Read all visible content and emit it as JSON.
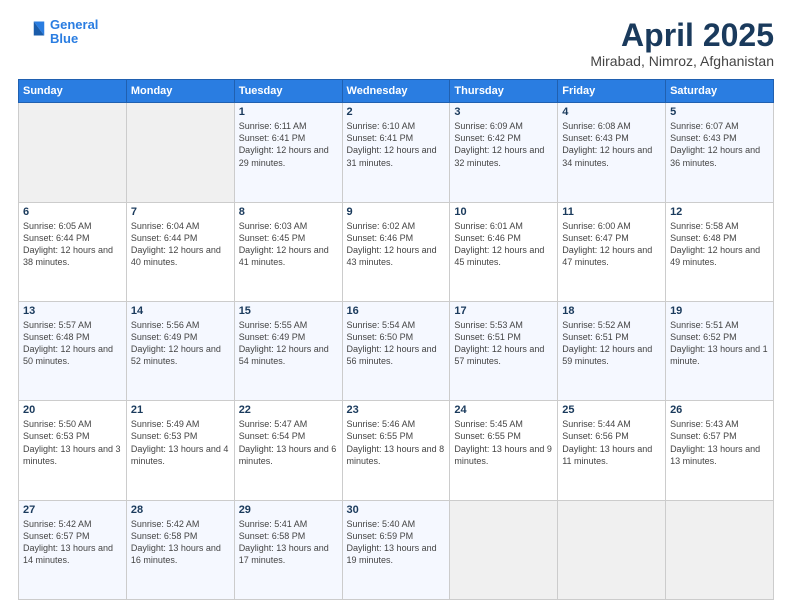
{
  "logo": {
    "line1": "General",
    "line2": "Blue"
  },
  "title": "April 2025",
  "subtitle": "Mirabad, Nimroz, Afghanistan",
  "days_of_week": [
    "Sunday",
    "Monday",
    "Tuesday",
    "Wednesday",
    "Thursday",
    "Friday",
    "Saturday"
  ],
  "weeks": [
    [
      {
        "num": "",
        "sunrise": "",
        "sunset": "",
        "daylight": ""
      },
      {
        "num": "",
        "sunrise": "",
        "sunset": "",
        "daylight": ""
      },
      {
        "num": "1",
        "sunrise": "Sunrise: 6:11 AM",
        "sunset": "Sunset: 6:41 PM",
        "daylight": "Daylight: 12 hours and 29 minutes."
      },
      {
        "num": "2",
        "sunrise": "Sunrise: 6:10 AM",
        "sunset": "Sunset: 6:41 PM",
        "daylight": "Daylight: 12 hours and 31 minutes."
      },
      {
        "num": "3",
        "sunrise": "Sunrise: 6:09 AM",
        "sunset": "Sunset: 6:42 PM",
        "daylight": "Daylight: 12 hours and 32 minutes."
      },
      {
        "num": "4",
        "sunrise": "Sunrise: 6:08 AM",
        "sunset": "Sunset: 6:43 PM",
        "daylight": "Daylight: 12 hours and 34 minutes."
      },
      {
        "num": "5",
        "sunrise": "Sunrise: 6:07 AM",
        "sunset": "Sunset: 6:43 PM",
        "daylight": "Daylight: 12 hours and 36 minutes."
      }
    ],
    [
      {
        "num": "6",
        "sunrise": "Sunrise: 6:05 AM",
        "sunset": "Sunset: 6:44 PM",
        "daylight": "Daylight: 12 hours and 38 minutes."
      },
      {
        "num": "7",
        "sunrise": "Sunrise: 6:04 AM",
        "sunset": "Sunset: 6:44 PM",
        "daylight": "Daylight: 12 hours and 40 minutes."
      },
      {
        "num": "8",
        "sunrise": "Sunrise: 6:03 AM",
        "sunset": "Sunset: 6:45 PM",
        "daylight": "Daylight: 12 hours and 41 minutes."
      },
      {
        "num": "9",
        "sunrise": "Sunrise: 6:02 AM",
        "sunset": "Sunset: 6:46 PM",
        "daylight": "Daylight: 12 hours and 43 minutes."
      },
      {
        "num": "10",
        "sunrise": "Sunrise: 6:01 AM",
        "sunset": "Sunset: 6:46 PM",
        "daylight": "Daylight: 12 hours and 45 minutes."
      },
      {
        "num": "11",
        "sunrise": "Sunrise: 6:00 AM",
        "sunset": "Sunset: 6:47 PM",
        "daylight": "Daylight: 12 hours and 47 minutes."
      },
      {
        "num": "12",
        "sunrise": "Sunrise: 5:58 AM",
        "sunset": "Sunset: 6:48 PM",
        "daylight": "Daylight: 12 hours and 49 minutes."
      }
    ],
    [
      {
        "num": "13",
        "sunrise": "Sunrise: 5:57 AM",
        "sunset": "Sunset: 6:48 PM",
        "daylight": "Daylight: 12 hours and 50 minutes."
      },
      {
        "num": "14",
        "sunrise": "Sunrise: 5:56 AM",
        "sunset": "Sunset: 6:49 PM",
        "daylight": "Daylight: 12 hours and 52 minutes."
      },
      {
        "num": "15",
        "sunrise": "Sunrise: 5:55 AM",
        "sunset": "Sunset: 6:49 PM",
        "daylight": "Daylight: 12 hours and 54 minutes."
      },
      {
        "num": "16",
        "sunrise": "Sunrise: 5:54 AM",
        "sunset": "Sunset: 6:50 PM",
        "daylight": "Daylight: 12 hours and 56 minutes."
      },
      {
        "num": "17",
        "sunrise": "Sunrise: 5:53 AM",
        "sunset": "Sunset: 6:51 PM",
        "daylight": "Daylight: 12 hours and 57 minutes."
      },
      {
        "num": "18",
        "sunrise": "Sunrise: 5:52 AM",
        "sunset": "Sunset: 6:51 PM",
        "daylight": "Daylight: 12 hours and 59 minutes."
      },
      {
        "num": "19",
        "sunrise": "Sunrise: 5:51 AM",
        "sunset": "Sunset: 6:52 PM",
        "daylight": "Daylight: 13 hours and 1 minute."
      }
    ],
    [
      {
        "num": "20",
        "sunrise": "Sunrise: 5:50 AM",
        "sunset": "Sunset: 6:53 PM",
        "daylight": "Daylight: 13 hours and 3 minutes."
      },
      {
        "num": "21",
        "sunrise": "Sunrise: 5:49 AM",
        "sunset": "Sunset: 6:53 PM",
        "daylight": "Daylight: 13 hours and 4 minutes."
      },
      {
        "num": "22",
        "sunrise": "Sunrise: 5:47 AM",
        "sunset": "Sunset: 6:54 PM",
        "daylight": "Daylight: 13 hours and 6 minutes."
      },
      {
        "num": "23",
        "sunrise": "Sunrise: 5:46 AM",
        "sunset": "Sunset: 6:55 PM",
        "daylight": "Daylight: 13 hours and 8 minutes."
      },
      {
        "num": "24",
        "sunrise": "Sunrise: 5:45 AM",
        "sunset": "Sunset: 6:55 PM",
        "daylight": "Daylight: 13 hours and 9 minutes."
      },
      {
        "num": "25",
        "sunrise": "Sunrise: 5:44 AM",
        "sunset": "Sunset: 6:56 PM",
        "daylight": "Daylight: 13 hours and 11 minutes."
      },
      {
        "num": "26",
        "sunrise": "Sunrise: 5:43 AM",
        "sunset": "Sunset: 6:57 PM",
        "daylight": "Daylight: 13 hours and 13 minutes."
      }
    ],
    [
      {
        "num": "27",
        "sunrise": "Sunrise: 5:42 AM",
        "sunset": "Sunset: 6:57 PM",
        "daylight": "Daylight: 13 hours and 14 minutes."
      },
      {
        "num": "28",
        "sunrise": "Sunrise: 5:42 AM",
        "sunset": "Sunset: 6:58 PM",
        "daylight": "Daylight: 13 hours and 16 minutes."
      },
      {
        "num": "29",
        "sunrise": "Sunrise: 5:41 AM",
        "sunset": "Sunset: 6:58 PM",
        "daylight": "Daylight: 13 hours and 17 minutes."
      },
      {
        "num": "30",
        "sunrise": "Sunrise: 5:40 AM",
        "sunset": "Sunset: 6:59 PM",
        "daylight": "Daylight: 13 hours and 19 minutes."
      },
      {
        "num": "",
        "sunrise": "",
        "sunset": "",
        "daylight": ""
      },
      {
        "num": "",
        "sunrise": "",
        "sunset": "",
        "daylight": ""
      },
      {
        "num": "",
        "sunrise": "",
        "sunset": "",
        "daylight": ""
      }
    ]
  ]
}
